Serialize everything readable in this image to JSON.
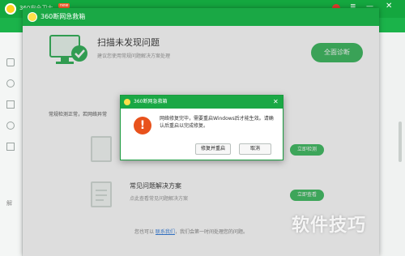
{
  "background_app": {
    "title": "360安全卫士",
    "badge": "new",
    "sidebar_label": "解"
  },
  "window": {
    "title": "360断网急救箱",
    "header": {
      "title": "扫描未发现问题",
      "subtitle": "建议您使用常规问题解决方案处理",
      "action_button": "全面诊断"
    },
    "status_text": "常规检测正常，若网络异常",
    "cards": [
      {
        "title": "",
        "desc": "",
        "button": "立即检测"
      },
      {
        "title": "常见问题解决方案",
        "desc": "点此查看常见问题解决方案",
        "button": "立即查看"
      }
    ],
    "footer_text": "您也可以 ",
    "footer_link": "联系我们",
    "footer_text2": "，我们会第一时间处理您的问题。"
  },
  "dialog": {
    "title": "360断网急救箱",
    "message": "网络修复完毕，需要重启Windows后才能生效。请确认后重启以完成修复。",
    "restart_button": "修复并重启",
    "cancel_button": "取消"
  },
  "watermark": "软件技巧",
  "colors": {
    "brand_green": "#1aa845",
    "warning": "#e8521c"
  }
}
